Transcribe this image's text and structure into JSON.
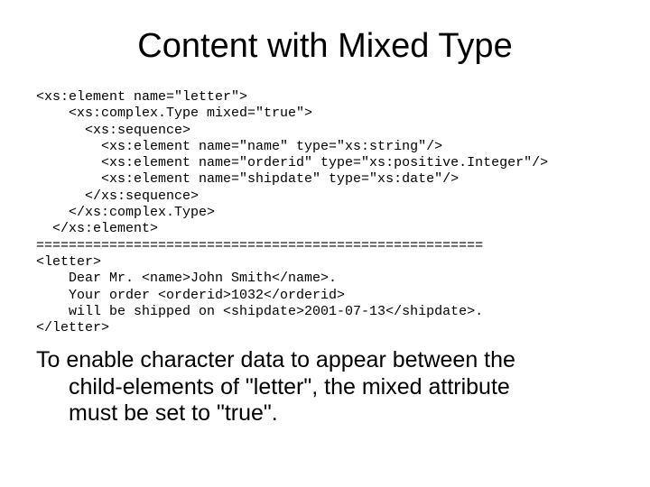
{
  "title": "Content with Mixed Type",
  "code": {
    "l1": "<xs:element name=\"letter\">",
    "l2": "    <xs:complex.Type mixed=\"true\">",
    "l3": "      <xs:sequence>",
    "l4": "        <xs:element name=\"name\" type=\"xs:string\"/>",
    "l5": "        <xs:element name=\"orderid\" type=\"xs:positive.Integer\"/>",
    "l6": "        <xs:element name=\"shipdate\" type=\"xs:date\"/>",
    "l7": "      </xs:sequence>",
    "l8": "    </xs:complex.Type>",
    "l9": "  </xs:element>",
    "l10": "=======================================================",
    "l11": "<letter>",
    "l12": "    Dear Mr. <name>John Smith</name>.",
    "l13": "    Your order <orderid>1032</orderid>",
    "l14": "    will be shipped on <shipdate>2001-07-13</shipdate>.",
    "l15": "</letter>"
  },
  "body": {
    "line1": "To enable character data to appear between the",
    "line2": "child-elements of \"letter\", the mixed attribute",
    "line3": "must be set to \"true\"."
  }
}
